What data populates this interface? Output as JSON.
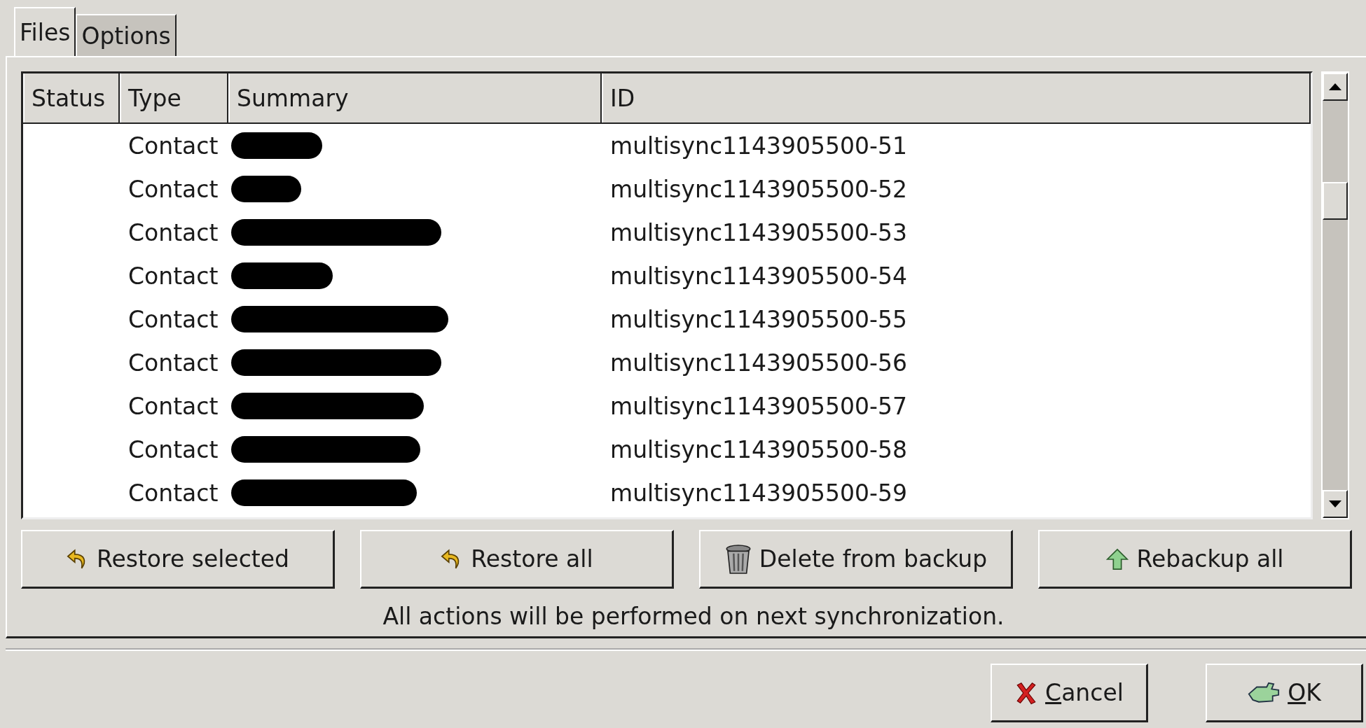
{
  "tabs": [
    {
      "label": "Files",
      "selected": true
    },
    {
      "label": "Options",
      "selected": false
    }
  ],
  "table": {
    "columns": [
      "Status",
      "Type",
      "Summary",
      "ID"
    ],
    "rows": [
      {
        "type": "Contact",
        "id": "multisync1143905500-51"
      },
      {
        "type": "Contact",
        "id": "multisync1143905500-52"
      },
      {
        "type": "Contact",
        "id": "multisync1143905500-53"
      },
      {
        "type": "Contact",
        "id": "multisync1143905500-54"
      },
      {
        "type": "Contact",
        "id": "multisync1143905500-55"
      },
      {
        "type": "Contact",
        "id": "multisync1143905500-56"
      },
      {
        "type": "Contact",
        "id": "multisync1143905500-57"
      },
      {
        "type": "Contact",
        "id": "multisync1143905500-58"
      },
      {
        "type": "Contact",
        "id": "multisync1143905500-59"
      }
    ]
  },
  "actions": [
    {
      "label": "Restore selected",
      "kind": "restore"
    },
    {
      "label": "Restore all",
      "kind": "restore"
    },
    {
      "label": "Delete from backup",
      "kind": "delete"
    },
    {
      "label": "Rebackup all",
      "kind": "rebackup"
    }
  ],
  "message": "All actions will be performed on next synchronization.",
  "dialog_buttons": [
    {
      "label": "Cancel",
      "kind": "cancel"
    },
    {
      "label": "OK",
      "kind": "ok"
    }
  ]
}
